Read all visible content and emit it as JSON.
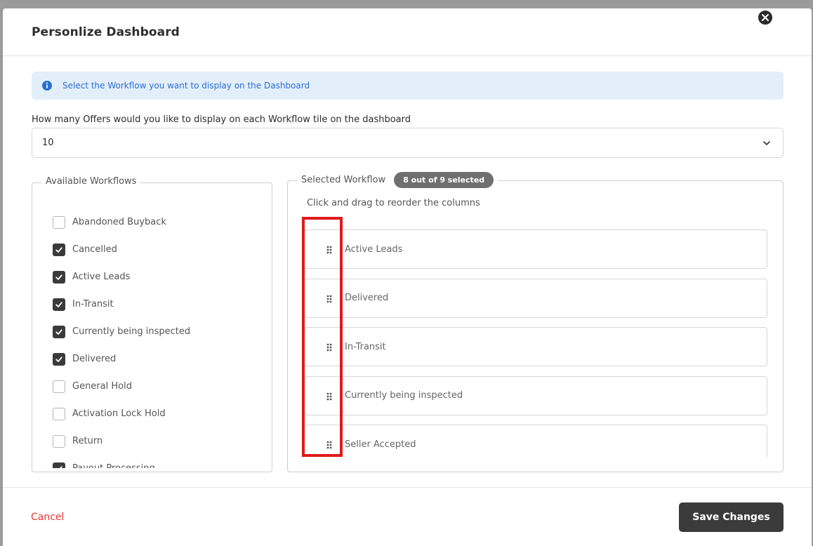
{
  "modal": {
    "title": "Personlize Dashboard"
  },
  "info": {
    "text": "Select the Workflow you want to display on the Dashboard"
  },
  "offers": {
    "question": "How many Offers would you like to display on each Workflow tile on the dashboard",
    "selected": "10"
  },
  "available": {
    "legend": "Available Workflows",
    "items": [
      {
        "label": "Abandoned Buyback",
        "checked": false
      },
      {
        "label": "Cancelled",
        "checked": true
      },
      {
        "label": "Active Leads",
        "checked": true
      },
      {
        "label": "In-Transit",
        "checked": true
      },
      {
        "label": "Currently being inspected",
        "checked": true
      },
      {
        "label": "Delivered",
        "checked": true
      },
      {
        "label": "General Hold",
        "checked": false
      },
      {
        "label": "Activation Lock Hold",
        "checked": false
      },
      {
        "label": "Return",
        "checked": false
      },
      {
        "label": "Payout Processing",
        "checked": true
      }
    ]
  },
  "selected": {
    "legend": "Selected Workflow",
    "badge": "8 out of 9 selected",
    "hint": "Click and drag to reorder the columns",
    "items": [
      {
        "label": "Active Leads"
      },
      {
        "label": "Delivered"
      },
      {
        "label": "In-Transit"
      },
      {
        "label": "Currently being inspected"
      },
      {
        "label": "Seller Accepted"
      }
    ]
  },
  "footer": {
    "cancel_label": "Cancel",
    "save_label": "Save Changes"
  },
  "colors": {
    "accent_danger": "#e53935",
    "info_bg": "#e3eefb",
    "info_text": "#2b6fd1",
    "primary_button": "#3b3b3b",
    "highlight": "#e0191b"
  }
}
